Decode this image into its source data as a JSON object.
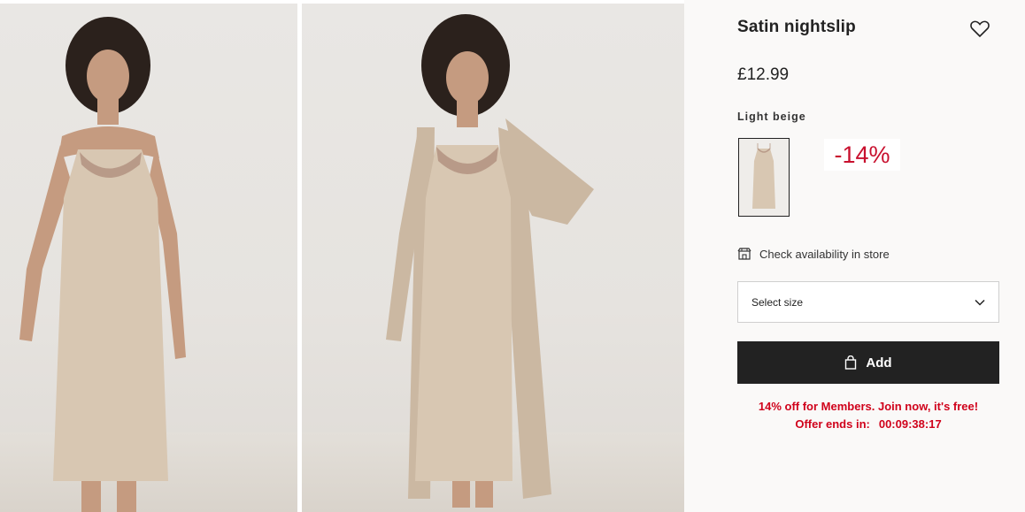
{
  "gallery": {
    "images": [
      {
        "alt": "Model wearing satin nightslip"
      },
      {
        "alt": "Model wearing satin nightslip with cardigan"
      }
    ]
  },
  "product": {
    "title": "Satin nightslip",
    "price": "£12.99",
    "color_name": "Light beige",
    "discount_badge": "-14%",
    "check_store_label": "Check availability in store",
    "size_select_label": "Select size",
    "add_label": "Add"
  },
  "promo": {
    "members_text": "14% off for Members. Join now, it's free!",
    "offer_label": "Offer ends in:",
    "countdown": "00:09:38:17"
  },
  "colors": {
    "accent_red": "#d0021b",
    "badge_red": "#c8102e",
    "button_dark": "#222222",
    "fabric": "#d8c7b2"
  },
  "icons": [
    "heart-icon",
    "store-icon",
    "chevron-down-icon",
    "bag-icon"
  ]
}
